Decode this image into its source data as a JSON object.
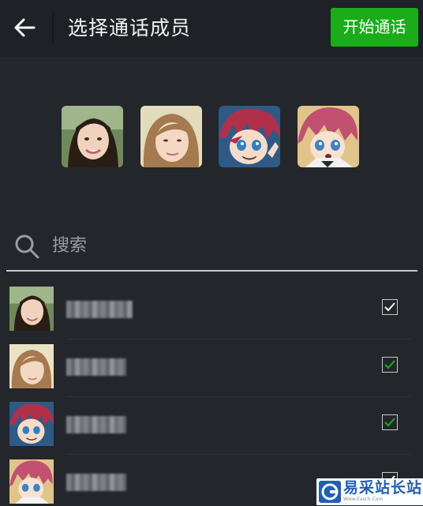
{
  "header": {
    "title": "选择通话成员",
    "start_button": "开始通话",
    "back_icon": "arrow-left-icon",
    "accent_color": "#1aad19"
  },
  "selected_members": [
    {
      "avatar": "girl-photo-1"
    },
    {
      "avatar": "girl-photo-2"
    },
    {
      "avatar": "anime-boy-1"
    },
    {
      "avatar": "anime-boy-2"
    }
  ],
  "search": {
    "placeholder": "搜索",
    "icon": "search-icon"
  },
  "contacts": [
    {
      "avatar": "girl-photo-1",
      "checked": true,
      "check_style": "white"
    },
    {
      "avatar": "girl-photo-2",
      "checked": true,
      "check_style": "green"
    },
    {
      "avatar": "anime-boy-1",
      "checked": true,
      "check_style": "green"
    },
    {
      "avatar": "anime-boy-2",
      "checked": true,
      "check_style": "white"
    }
  ],
  "watermark": {
    "title": "易采站长站",
    "subtitle": "Www.Easck.Com"
  }
}
